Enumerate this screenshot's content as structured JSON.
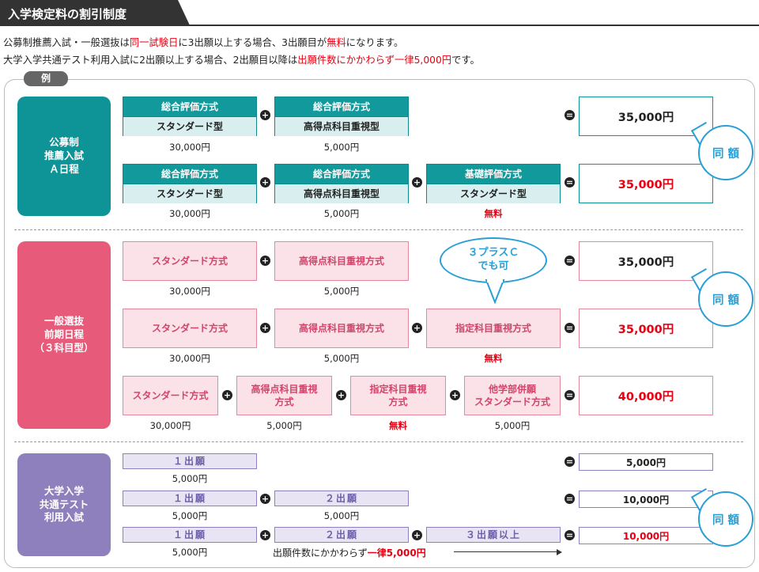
{
  "header": {
    "title": "入学検定料の割引制度"
  },
  "intro": {
    "line1": {
      "a": "公募制推薦入試・一般選抜は",
      "b": "同一試験日",
      "c": "に3出願以上する場合、3出願目が",
      "d": "無料",
      "e": "になります。"
    },
    "line2": {
      "a": "大学入学共通テスト利用入試に2出願以上する場合、2出願目以降は",
      "b": "出願件数にかかわらず一律5,000円",
      "c": "です。"
    }
  },
  "example_label": "例",
  "categories": {
    "koubo": "公募制\n推薦入試\nＡ日程",
    "ippan": "一般選抜\n前期日程\n（３科目型）",
    "kyotsu": "大学入学\n共通テスト\n利用入試"
  },
  "koubo": {
    "r1": {
      "b1": {
        "top": "総合評価方式",
        "bot": "スタンダード型",
        "price": "30,000円"
      },
      "b2": {
        "top": "総合評価方式",
        "bot": "高得点科目重視型",
        "price": "5,000円"
      },
      "result": "35,000円"
    },
    "r2": {
      "b1": {
        "top": "総合評価方式",
        "bot": "スタンダード型",
        "price": "30,000円"
      },
      "b2": {
        "top": "総合評価方式",
        "bot": "高得点科目重視型",
        "price": "5,000円"
      },
      "b3": {
        "top": "基礎評価方式",
        "bot": "スタンダード型",
        "price": "無料"
      },
      "result": "35,000円"
    }
  },
  "ippan": {
    "r1": {
      "b1": "スタンダード方式",
      "p1": "30,000円",
      "b2": "高得点科目重視方式",
      "p2": "5,000円",
      "result": "35,000円"
    },
    "r2": {
      "b1": "スタンダード方式",
      "p1": "30,000円",
      "b2": "高得点科目重視方式",
      "p2": "5,000円",
      "b3": "指定科目重視方式",
      "p3": "無料",
      "result": "35,000円"
    },
    "r3": {
      "b1": "スタンダード方式",
      "p1": "30,000円",
      "b2": "高得点科目重視\n方式",
      "p2": "5,000円",
      "b3": "指定科目重視\n方式",
      "p3": "無料",
      "b4": "他学部併願\nスタンダード方式",
      "p4": "5,000円",
      "result": "40,000円"
    },
    "callout": "３プラスＣ\nでも可"
  },
  "kyotsu": {
    "r1": {
      "b1": "１出願",
      "p1": "5,000円",
      "result": "5,000円"
    },
    "r2": {
      "b1": "１出願",
      "p1": "5,000円",
      "b2": "２出願",
      "p2": "5,000円",
      "result": "10,000円"
    },
    "r3": {
      "b1": "１出願",
      "p1": "5,000円",
      "b2": "２出願",
      "b3": "３出願以上",
      "result": "10,000円"
    },
    "note_a": "出願件数にかかわらず",
    "note_b": "一律5,000円"
  },
  "same": "同 額",
  "ops": {
    "plus": "+",
    "equals": "="
  },
  "colors": {
    "teal": "#0e9396",
    "pink": "#e85a7a",
    "purple": "#8e80bd",
    "red": "#e50012",
    "blue": "#2a9fd6"
  }
}
